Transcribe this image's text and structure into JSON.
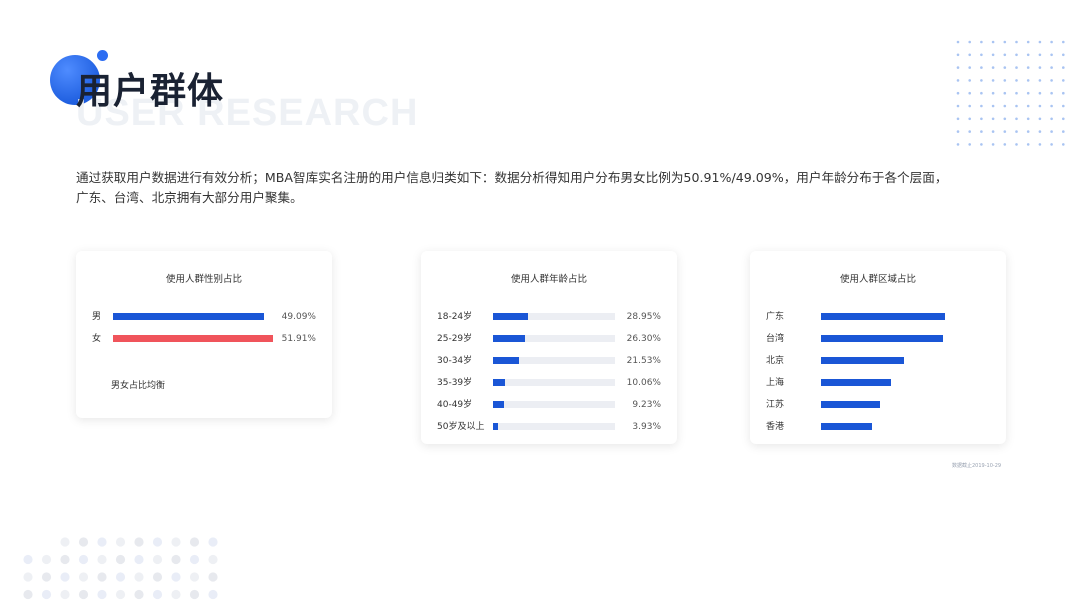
{
  "page": {
    "title": "用户群体",
    "subtitle_en": "USER RESEARCH",
    "intro_line1": "通过获取用户数据进行有效分析；MBA智库实名注册的用户信息归类如下：数据分析得知用户分布男女比例为50.91%/49.09%，用户年龄分布于各个层面，",
    "intro_line2": "广东、台湾、北京拥有大部分用户聚集。",
    "footnote": "数据截止2019-10-29"
  },
  "colors": {
    "accent_blue": "#1a56d6",
    "accent_red": "#f0545b",
    "track": "#eceef3",
    "title": "#1a2233"
  },
  "icons": [
    "blue-orb-icon"
  ],
  "chart_data": [
    {
      "type": "bar",
      "title": "使用人群性别占比",
      "orientation": "horizontal",
      "categories": [
        "男",
        "女"
      ],
      "values": [
        49.09,
        51.91
      ],
      "value_labels": [
        "49.09%",
        "51.91%"
      ],
      "colors": [
        "#1a56d6",
        "#f0545b"
      ],
      "note": "男女占比均衡",
      "xlim": [
        0,
        52
      ]
    },
    {
      "type": "bar",
      "title": "使用人群年龄占比",
      "orientation": "horizontal",
      "categories": [
        "18-24岁",
        "25-29岁",
        "30-34岁",
        "35-39岁",
        "40-49岁",
        "50岁及以上"
      ],
      "values": [
        28.95,
        26.3,
        21.53,
        10.06,
        9.23,
        3.93
      ],
      "value_labels": [
        "28.95%",
        "26.30%",
        "21.53%",
        "10.06%",
        "9.23%",
        "3.93%"
      ],
      "xlim": [
        0,
        100
      ]
    },
    {
      "type": "bar",
      "title": "使用人群区域占比",
      "orientation": "horizontal",
      "categories": [
        "广东",
        "台湾",
        "北京",
        "上海",
        "江苏",
        "香港"
      ],
      "values": [
        95,
        94,
        64,
        54,
        45,
        39
      ],
      "xlim": [
        0,
        100
      ]
    }
  ]
}
